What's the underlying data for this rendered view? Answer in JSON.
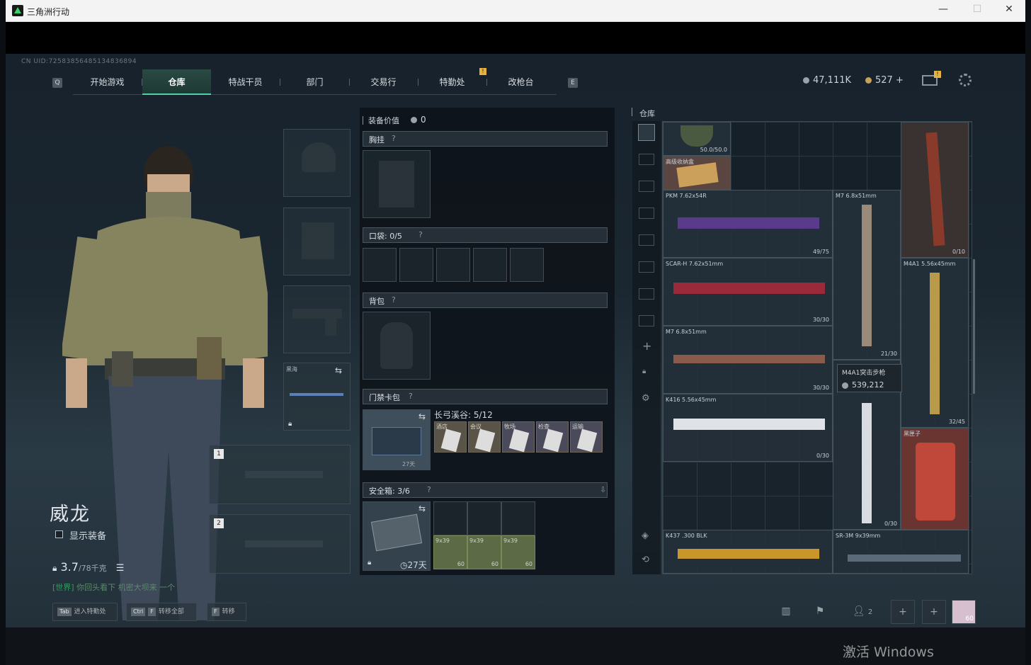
{
  "window": {
    "title": "三角洲行动"
  },
  "top": {
    "uid": "CN UID:72583856485134836894",
    "nav_left_key": "Q",
    "nav_right_key": "E",
    "tabs": [
      "开始游戏",
      "仓库",
      "特战干员",
      "部门",
      "交易行",
      "特勤处",
      "改枪台"
    ],
    "active_tab": "仓库",
    "currency_primary": "47,111K",
    "currency_secondary": "527 +"
  },
  "colors": {
    "accent": "#4fd1a8",
    "badge": "#e6b23d",
    "chat": "#2e9e5c"
  },
  "character": {
    "name": "威龙",
    "show_gear_label": "显示装备",
    "weight": "3.7",
    "weight_max": "/78千克",
    "chat_channel": "[世界]",
    "chat_text": "你回头看下 机密大坝来 一个"
  },
  "gear": {
    "sidearm_label": "黑海",
    "slot1": "1",
    "slot2": "2"
  },
  "equipment": {
    "title": "装备价值",
    "value": "0",
    "chest_rig": "胸挂",
    "pockets": "口袋: 0/5",
    "backpack": "背包",
    "keycard_bag": "门禁卡包",
    "keycard_map": "长弓溪谷: 5/12",
    "keycard_names": [
      "酒店",
      "会议",
      "牧场",
      "检查",
      "运输"
    ],
    "keycard_time": "27天",
    "safe_box": "安全箱: 3/6",
    "safe_time": "27天",
    "ammo": [
      {
        "cal": "9x39",
        "count": "60"
      },
      {
        "cal": "9x39",
        "count": "60"
      },
      {
        "cal": "9x39",
        "count": "60"
      }
    ]
  },
  "warehouse": {
    "title": "仓库",
    "items": [
      {
        "name": "",
        "count": "50.0/50.0"
      },
      {
        "name": "高级收纳盒",
        "count": ""
      },
      {
        "name": "PKM 7.62x54R",
        "count": "49/75"
      },
      {
        "name": "M7 6.8x51mm",
        "count": "21/30"
      },
      {
        "name": "",
        "count": "0/10"
      },
      {
        "name": "SCAR-H 7.62x51mm",
        "count": "30/30"
      },
      {
        "name": "M4A1 5.56x45mm",
        "count": "32/45"
      },
      {
        "name": "M7 6.8x51mm",
        "count": "30/30"
      },
      {
        "name": "K416 5.56x45mm",
        "count": "0/30"
      },
      {
        "name": "",
        "count": "0/30"
      },
      {
        "name": "黑匣子",
        "count": ""
      },
      {
        "name": "K437 .300 BLK",
        "count": ""
      },
      {
        "name": "SR-3M 9x39mm",
        "count": ""
      }
    ],
    "tooltip_name": "M4A1突击步枪",
    "tooltip_value": "539,212"
  },
  "bottom": {
    "btn1_key": "Tab",
    "btn1": "进入特勤处",
    "btn2_key1": "Ctrl",
    "btn2_key2": "F",
    "btn2": "转移全部",
    "btn3_key": "F",
    "btn3": "转移",
    "squad_count": "2",
    "avatar_level": "60"
  },
  "os": {
    "watermark": "激活 Windows"
  }
}
